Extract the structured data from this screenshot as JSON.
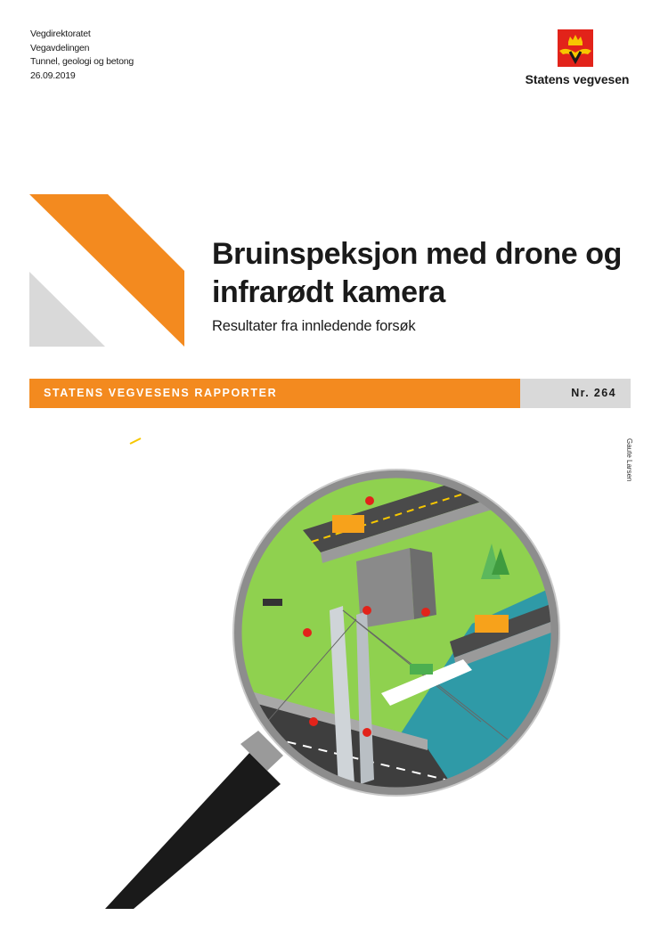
{
  "meta": {
    "line1": "Vegdirektoratet",
    "line2": "Vegavdelingen",
    "line3": "Tunnel, geologi og betong",
    "date": "26.09.2019"
  },
  "logo": {
    "name": "Statens vegvesen",
    "icon": "statens-vegvesen-emblem"
  },
  "title": {
    "line1": "Bruinspeksjon med drone og",
    "line2": "infrarødt kamera"
  },
  "subtitle": "Resultater fra innledende forsøk",
  "series_band": {
    "label": "STATENS VEGVESENS RAPPORTER",
    "number": "Nr. 264"
  },
  "photo_credit": "Gaute Larsen",
  "colors": {
    "orange": "#f38a1f",
    "grey": "#d9d9d9",
    "logo_red": "#e2231a",
    "logo_yellow": "#f7c700"
  },
  "illustration": {
    "description_icon": "magnifying-glass-bridge-inspection-icon"
  }
}
